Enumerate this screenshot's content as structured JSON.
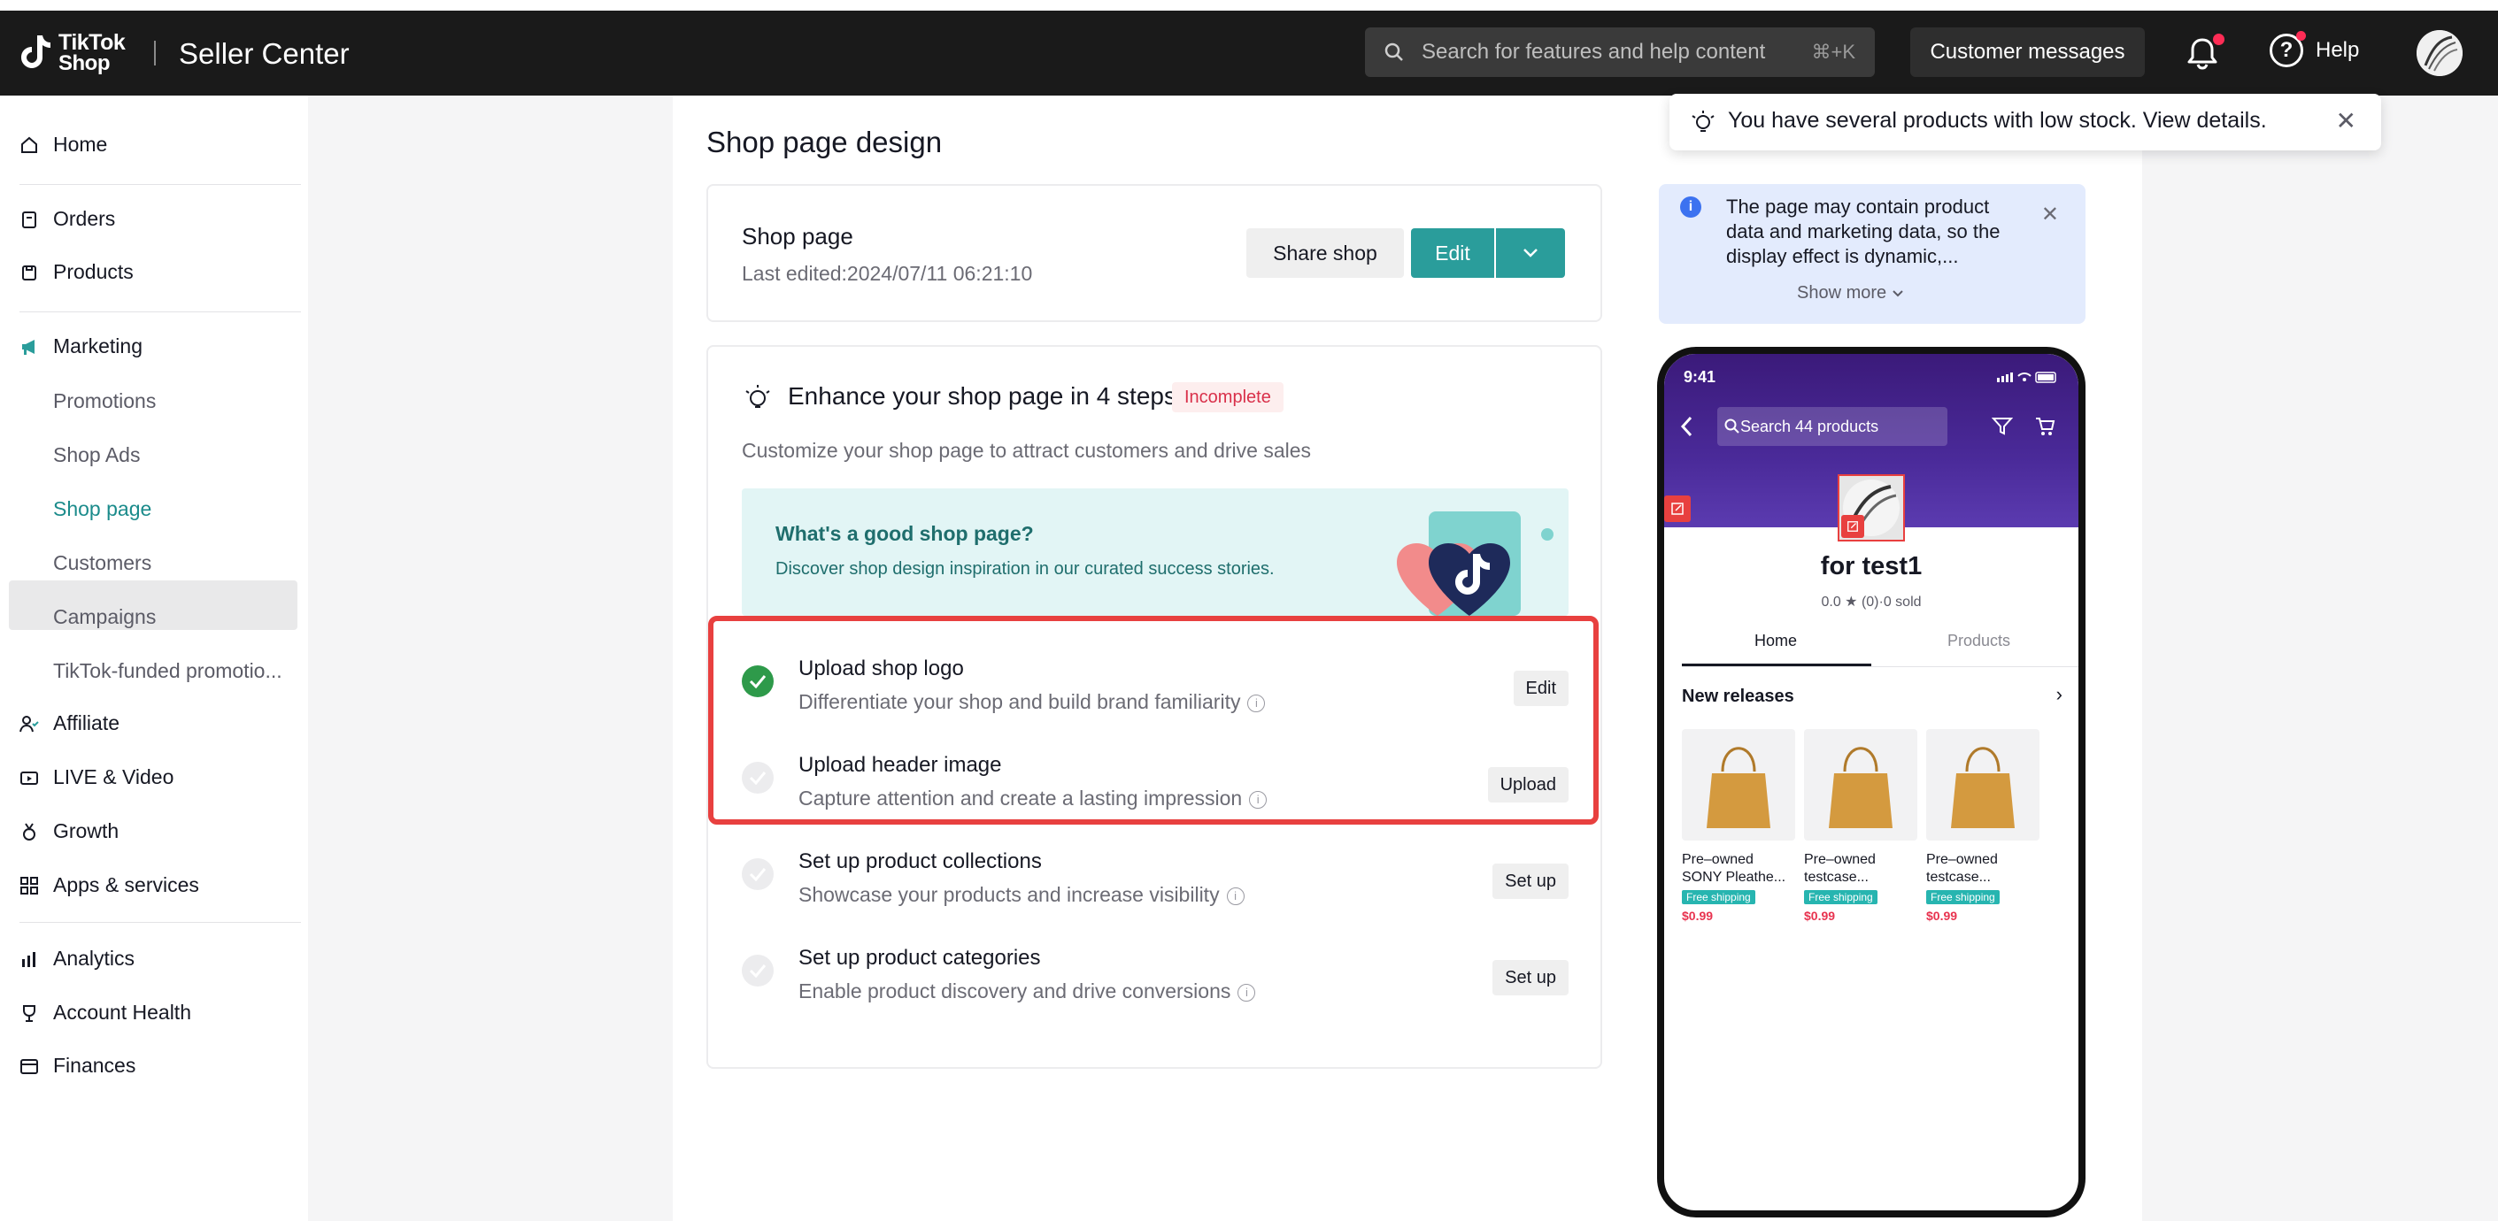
{
  "header": {
    "logo_line1": "TikTok",
    "logo_line2": "Shop",
    "product_name": "Seller Center",
    "search_placeholder": "Search for features and help content",
    "search_shortcut": "⌘+K",
    "customer_messages": "Customer messages",
    "help": "Help"
  },
  "sidebar": {
    "items": [
      {
        "label": "Home",
        "icon": "home-icon"
      },
      {
        "label": "Orders",
        "icon": "orders-icon"
      },
      {
        "label": "Products",
        "icon": "products-icon"
      },
      {
        "label": "Marketing",
        "icon": "megaphone-icon"
      },
      {
        "label": "Promotions"
      },
      {
        "label": "Shop Ads"
      },
      {
        "label": "Shop page"
      },
      {
        "label": "Customers"
      },
      {
        "label": "Campaigns"
      },
      {
        "label": "TikTok-funded promotio..."
      },
      {
        "label": "Affiliate",
        "icon": "affiliate-icon"
      },
      {
        "label": "LIVE & Video",
        "icon": "video-icon"
      },
      {
        "label": "Growth",
        "icon": "growth-icon"
      },
      {
        "label": "Apps & services",
        "icon": "apps-icon"
      },
      {
        "label": "Analytics",
        "icon": "analytics-icon"
      },
      {
        "label": "Account Health",
        "icon": "trophy-icon"
      },
      {
        "label": "Finances",
        "icon": "wallet-icon"
      }
    ],
    "active": "Shop page"
  },
  "main": {
    "page_title": "Shop page design",
    "shop_card": {
      "title": "Shop page",
      "last_edited": "Last edited:2024/07/11 06:21:10",
      "share_label": "Share shop",
      "edit_label": "Edit"
    },
    "enhance": {
      "title": "Enhance your shop page in 4 steps",
      "badge": "Incomplete",
      "subtitle": "Customize your shop page to attract customers and drive sales",
      "banner_title": "What's a good shop page?",
      "banner_sub": "Discover shop design inspiration in our curated success stories.",
      "steps": [
        {
          "title": "Upload shop logo",
          "desc": "Differentiate your shop and build brand familiarity",
          "action": "Edit",
          "done": true
        },
        {
          "title": "Upload header image",
          "desc": "Capture attention and create a lasting impression",
          "action": "Upload",
          "done": false
        },
        {
          "title": "Set up product collections",
          "desc": "Showcase your products and increase visibility",
          "action": "Set up",
          "done": false
        },
        {
          "title": "Set up product categories",
          "desc": "Enable product discovery and drive conversions",
          "action": "Set up",
          "done": false
        }
      ]
    }
  },
  "toast": {
    "text": "You have several products with low stock. View details."
  },
  "notice": {
    "text": "The page may contain product data and marketing data, so the display effect is dynamic,...",
    "show_more": "Show more"
  },
  "preview": {
    "time": "9:41",
    "search_placeholder": "Search 44 products",
    "shop_name": "for test1",
    "rating": "0.0 ★ (0)·0 sold",
    "tabs": [
      "Home",
      "Products"
    ],
    "section": "New releases",
    "products": [
      {
        "name_line1": "Pre–owned",
        "name_line2": "SONY Pleathe...",
        "shipping": "Free shipping",
        "price": "$0.99"
      },
      {
        "name_line1": "Pre–owned",
        "name_line2": "testcase...",
        "shipping": "Free shipping",
        "price": "$0.99"
      },
      {
        "name_line1": "Pre–owned",
        "name_line2": "testcase...",
        "shipping": "Free shipping",
        "price": "$0.99"
      }
    ]
  },
  "colors": {
    "accent": "#2a9d9b",
    "highlight": "#e8403f",
    "done": "#2e9a4a"
  }
}
